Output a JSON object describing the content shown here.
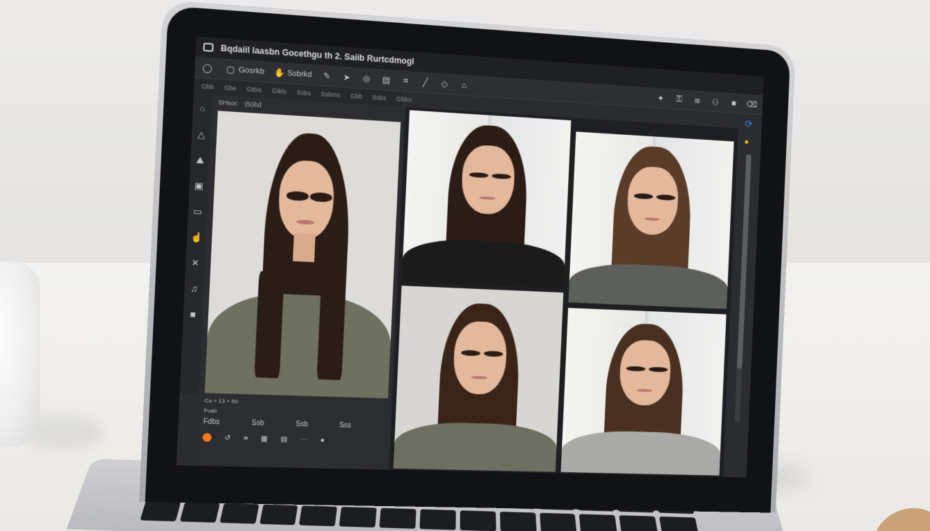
{
  "app": {
    "title": "Bqdaiil laasbn Gocethgu th 2. Saiib Rurtcdmogl"
  },
  "toolbar": {
    "items": [
      {
        "label": "",
        "icon": "circle-icon"
      },
      {
        "label": "Gosrkb",
        "icon": "square-icon"
      },
      {
        "label": "Ssbrkd",
        "icon": "hand-icon"
      },
      {
        "label": "",
        "icon": "pen-icon"
      },
      {
        "label": "",
        "icon": "arrow-icon"
      },
      {
        "label": "",
        "icon": "globe-icon"
      },
      {
        "label": "",
        "icon": "doc-icon"
      },
      {
        "label": "",
        "icon": "crop-icon"
      },
      {
        "label": "",
        "icon": "brush-icon"
      },
      {
        "label": "",
        "icon": "shape-icon"
      },
      {
        "label": "",
        "icon": "tag-icon"
      }
    ],
    "right_items": [
      {
        "icon": "wand-icon"
      },
      {
        "icon": "key-icon"
      },
      {
        "icon": "wifi-icon"
      },
      {
        "icon": "people-icon"
      },
      {
        "icon": "square-icon"
      },
      {
        "icon": "trash-icon"
      }
    ]
  },
  "menu": [
    "Gbb",
    "Gbe",
    "Gtbis",
    "Gtkls",
    "Ssbs",
    "Ssbms",
    "Gbb",
    "Ssbs",
    "Gbbo"
  ],
  "tool_rail": [
    "circle",
    "triangle",
    "mountain",
    "page",
    "rounded-rect",
    "hand",
    "cross",
    "bell",
    "square"
  ],
  "left_panel": {
    "tabs": [
      "SHsoc",
      "(5(ibd"
    ],
    "caption": "Ca + 13 + 50",
    "layer_label": "Fuab",
    "row1": [
      "Fdbs",
      "Ssb",
      "Ssb",
      "Sss"
    ],
    "row2_icons": [
      "orange-dot",
      "undo-icon",
      "crop-icon",
      "grid-icon",
      "doc-icon",
      "more-icon",
      "dot-icon"
    ]
  },
  "grid": {
    "photos": [
      {
        "name": "portrait-window-black-shirt"
      },
      {
        "name": "portrait-window-gray-shirt"
      },
      {
        "name": "portrait-plain-gray-shirt"
      },
      {
        "name": "portrait-window-light-gray-shirt"
      }
    ]
  },
  "right_rail": {
    "sync_icon": "sync-icon",
    "bulb_icon": "bulb-icon"
  }
}
